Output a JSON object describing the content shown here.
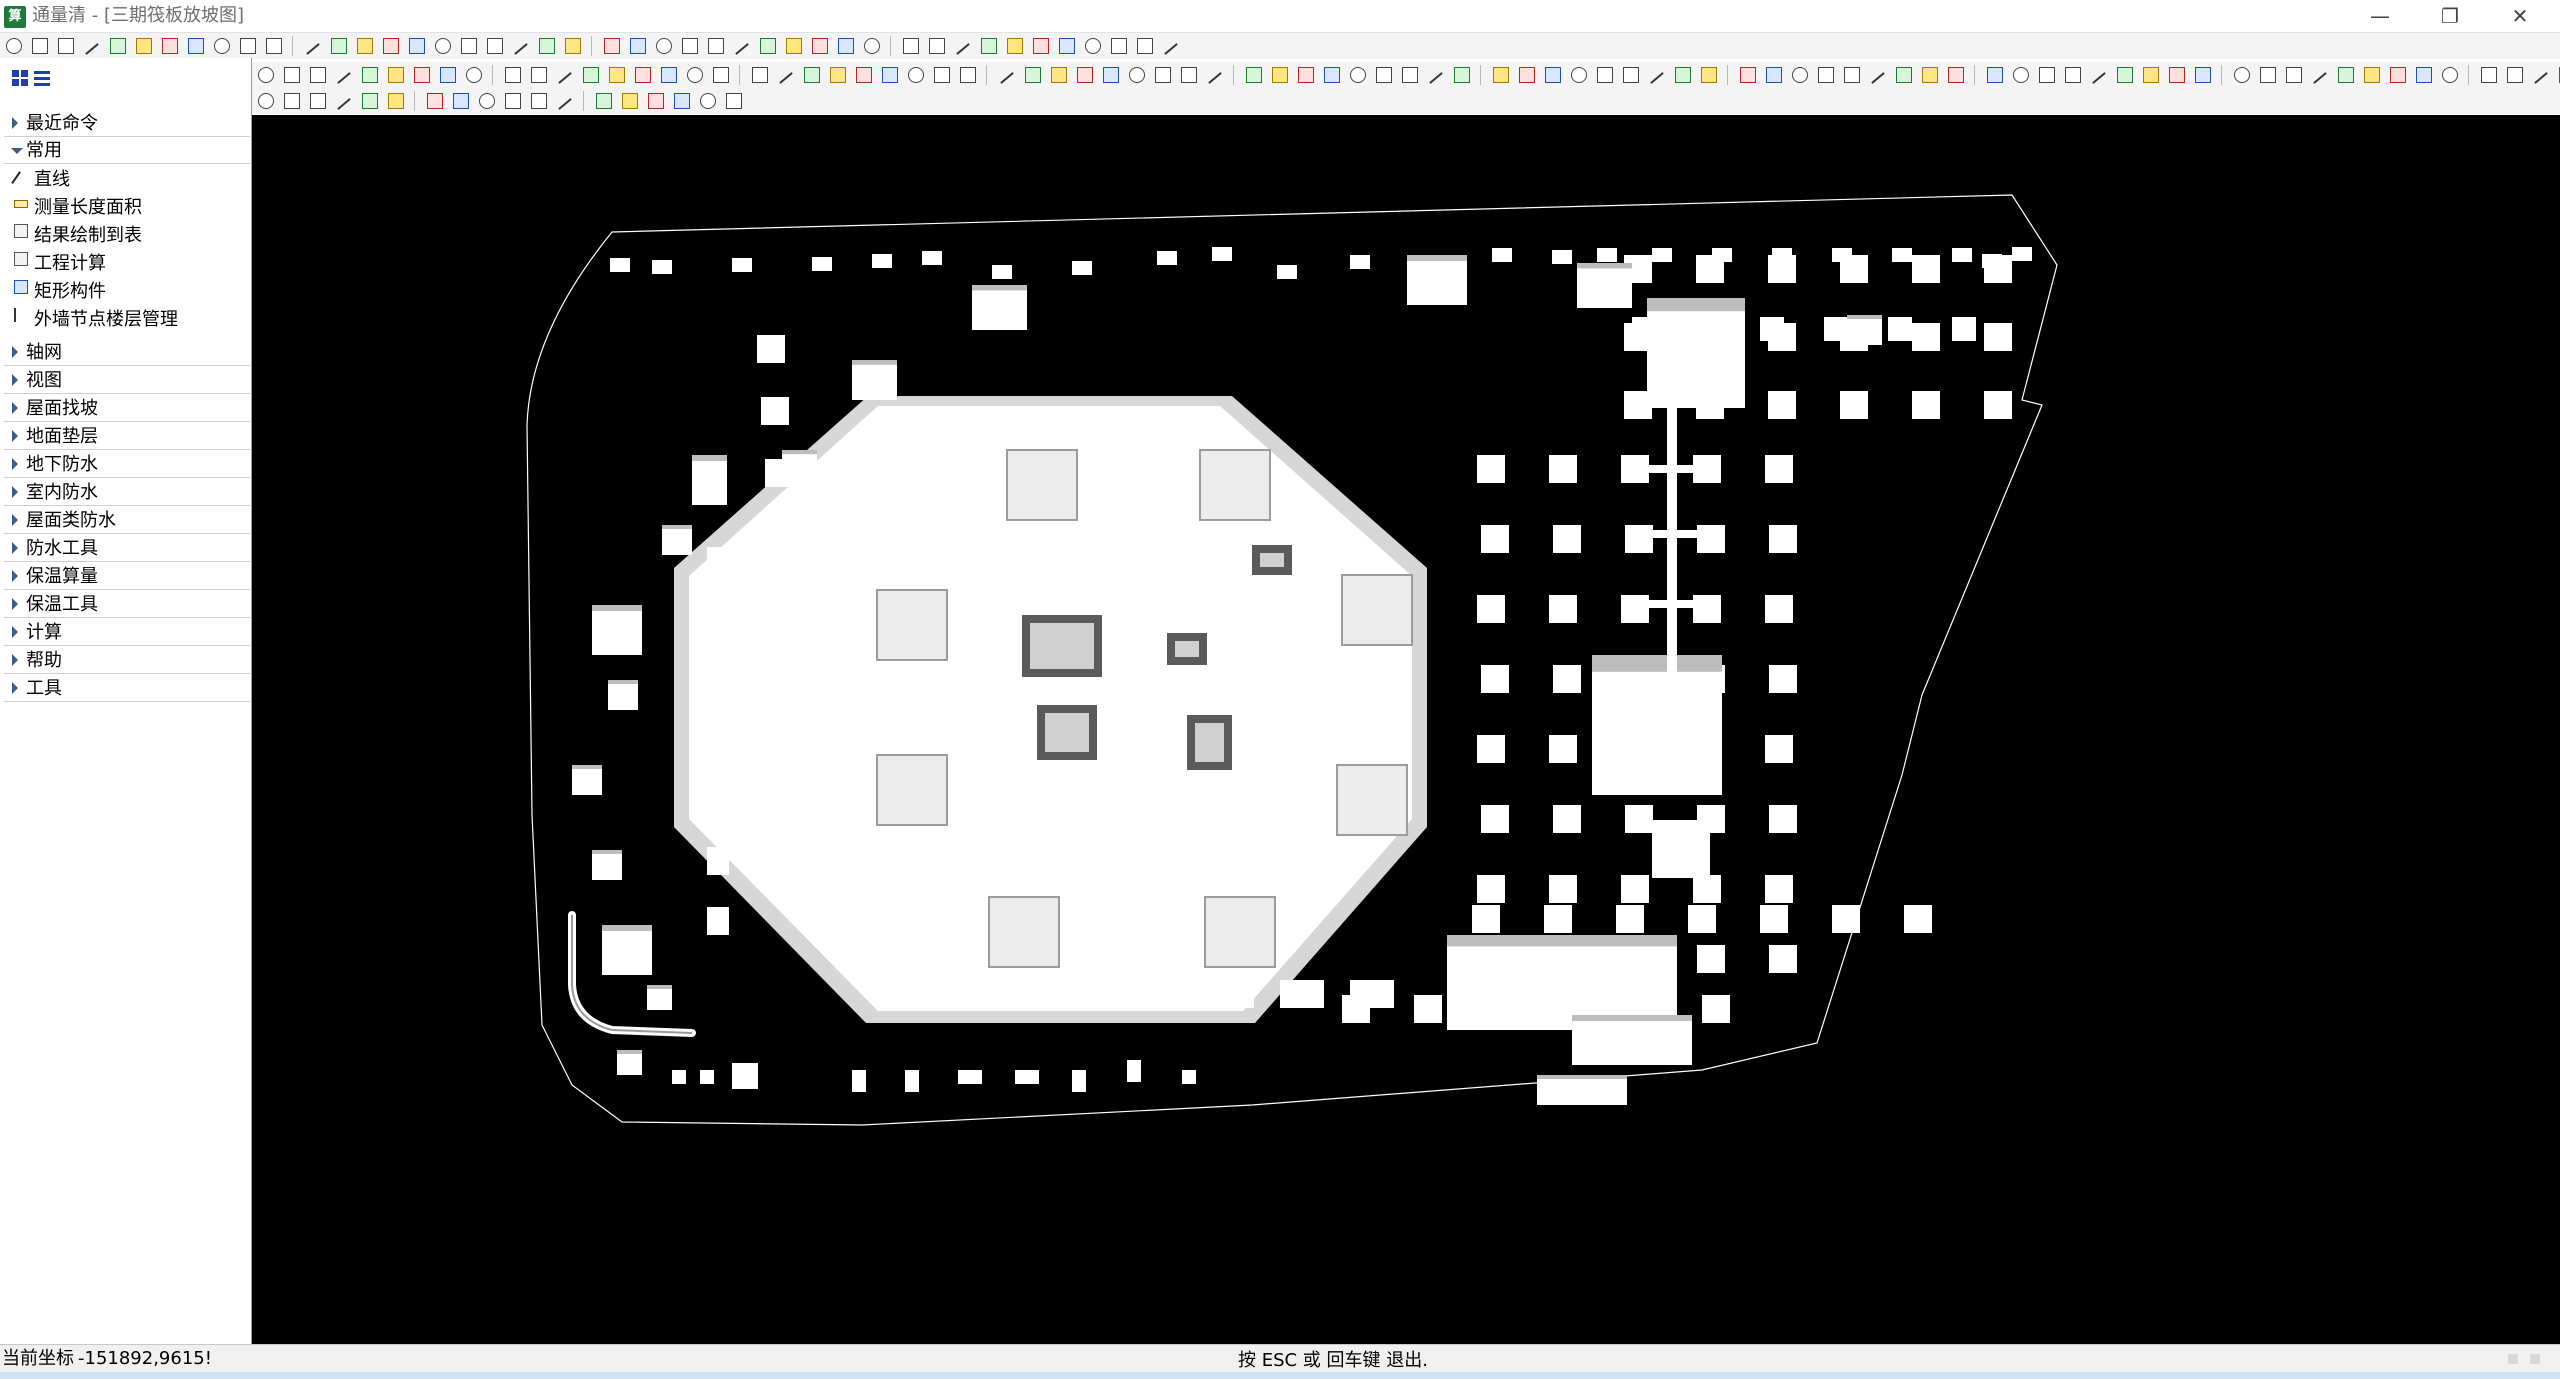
{
  "window": {
    "app_icon_text": "算",
    "title": "通量清 - [三期筏板放坡图]",
    "minimize": "—",
    "restore": "❐",
    "close": "✕"
  },
  "sidebar": {
    "groups_top": [
      {
        "label": "最近命令"
      }
    ],
    "open_group": "常用",
    "commands": [
      {
        "label": "直线",
        "icon": "line-icon"
      },
      {
        "label": "测量长度面积",
        "icon": "measure-icon"
      },
      {
        "label": "结果绘制到表",
        "icon": "table-icon"
      },
      {
        "label": "工程计算",
        "icon": "calculator-icon"
      },
      {
        "label": "矩形构件",
        "icon": "rectangle-icon"
      },
      {
        "label": "外墙节点楼层管理",
        "icon": "floor-manage-icon"
      }
    ],
    "groups": [
      {
        "label": "轴网"
      },
      {
        "label": "视图"
      },
      {
        "label": "屋面找坡"
      },
      {
        "label": "地面垫层"
      },
      {
        "label": "地下防水"
      },
      {
        "label": "室内防水"
      },
      {
        "label": "屋面类防水"
      },
      {
        "label": "防水工具"
      },
      {
        "label": "保温算量"
      },
      {
        "label": "保温工具"
      },
      {
        "label": "计算"
      },
      {
        "label": "帮助"
      },
      {
        "label": "工具"
      }
    ]
  },
  "status": {
    "coord_label": "当前坐标",
    "coord_value": "-151892,9615!",
    "message": "按 ESC 或 回车键 退出."
  },
  "colors": {
    "canvas_bg": "#000000",
    "shape_fill": "#ffffff",
    "accent": "#1f3fb0"
  }
}
